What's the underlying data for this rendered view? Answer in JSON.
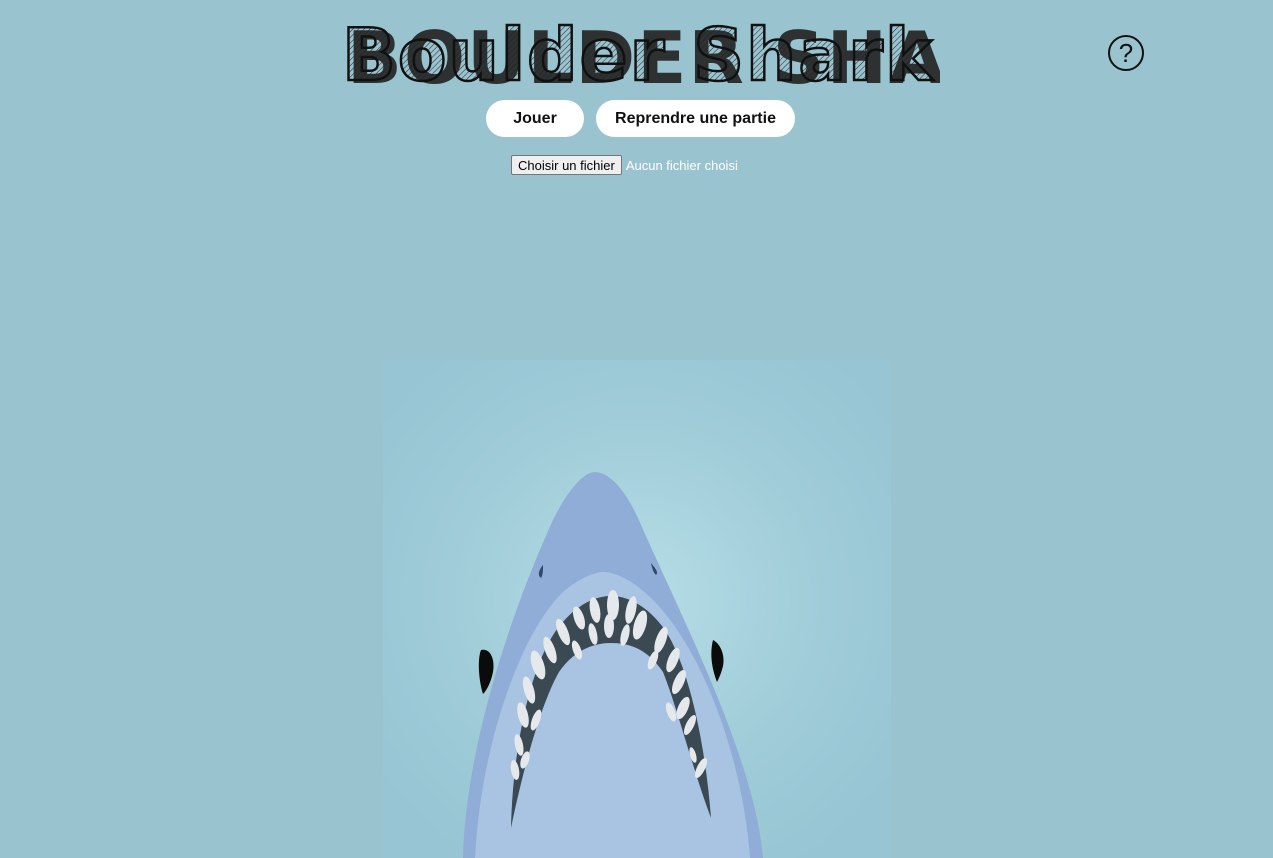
{
  "title": "Boulder Shark",
  "help": {
    "label": "?"
  },
  "buttons": {
    "play_label": "Jouer",
    "resume_label": "Reprendre une partie"
  },
  "file_input": {
    "button_label": "Choisir un fichier",
    "status_text": "Aucun fichier choisi"
  },
  "colors": {
    "background": "#9ac3d0",
    "scene_glow": "#b6dde6",
    "shark_body": "#8fadd6",
    "shark_inner": "#a9c3e3",
    "mouth": "#3b4a52",
    "teeth": "#e6e9ec",
    "button_bg": "#ffffff"
  }
}
